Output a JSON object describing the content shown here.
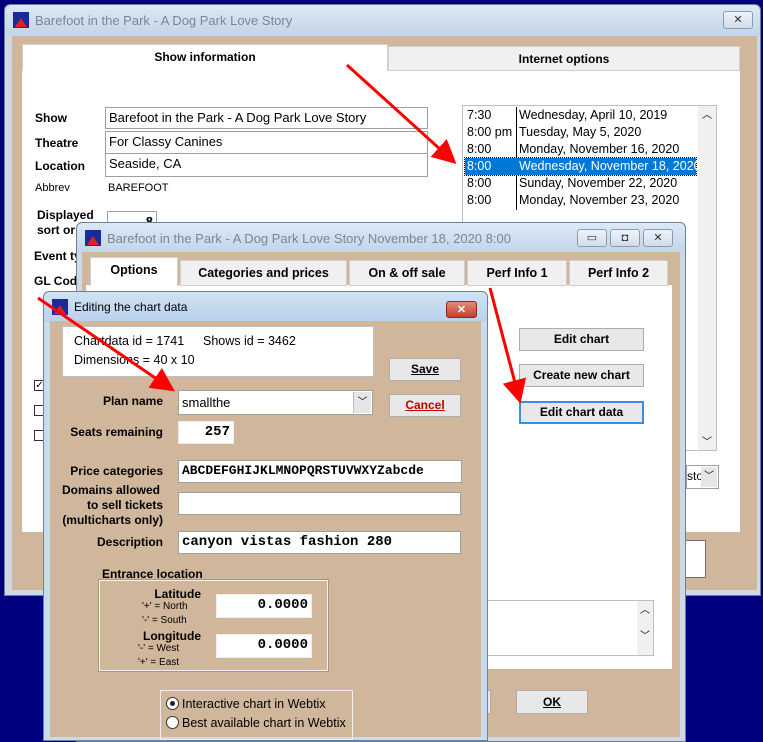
{
  "main_window": {
    "title": "Barefoot in the Park - A Dog Park Love Story",
    "tabs": [
      "Show information",
      "Internet options"
    ],
    "fields": {
      "show_label": "Show",
      "show": "Barefoot in the Park - A Dog Park Love Story",
      "theatre_label": "Theatre",
      "theatre": "For Classy Canines",
      "location_label": "Location",
      "location": "Seaside, CA",
      "abbrev_label": "Abbrev",
      "abbrev": "BAREFOOT",
      "sort_label_1": "Displayed",
      "sort_label_2": "sort or",
      "sort_value": "8",
      "event_label": "Event ty",
      "gl_label": "GL Cod",
      "dropdown_partial": "stor"
    },
    "performances": [
      {
        "time": "7:30",
        "date": "Wednesday, April 10, 2019"
      },
      {
        "time": "8:00 pm",
        "date": "Tuesday, May 5, 2020"
      },
      {
        "time": "8:00",
        "date": "Monday, November 16, 2020"
      },
      {
        "time": "8:00",
        "date": "Wednesday, November 18, 2020",
        "selected": true
      },
      {
        "time": "8:00",
        "date": "Sunday, November 22, 2020"
      },
      {
        "time": "8:00",
        "date": "Monday, November 23, 2020"
      }
    ]
  },
  "perf_window": {
    "title": "Barefoot in the Park - A Dog Park Love Story November 18, 2020 8:00",
    "tabs": [
      "Options",
      "Categories and prices",
      "On & off sale",
      "Perf Info 1",
      "Perf Info 2"
    ],
    "buttons": {
      "edit_chart": "Edit chart",
      "create_chart": "Create new chart",
      "edit_chart_data": "Edit chart data",
      "ok": "OK"
    }
  },
  "chart_dialog": {
    "title": "Editing the chart data",
    "chartdata_id": "Chartdata id = 1741",
    "shows_id": "Shows id = 3462",
    "dimensions": "Dimensions = 40 x 10",
    "save": "Save",
    "cancel": "Cancel",
    "plan_name_label": "Plan name",
    "plan_name": "smallthe",
    "seats_label": "Seats remaining",
    "seats": "257",
    "price_label": "Price categories",
    "price": "ABCDEFGHIJKLMNOPQRSTUVWXYZabcde",
    "domains_label_1": "Domains allowed",
    "domains_label_2": "to sell tickets",
    "domains_label_3": "(multicharts only)",
    "domains": "",
    "description_label": "Description",
    "description": "canyon vistas fashion 280",
    "entrance_label": "Entrance location",
    "lat_label": "Latitude",
    "lat_hint1": "'+' = North",
    "lat_hint2": "'-' = South",
    "latitude": "0.0000",
    "lon_label": "Longitude",
    "lon_hint1": "'-' = West",
    "lon_hint2": "'+' = East",
    "longitude": "0.0000",
    "radio_options": [
      {
        "label": "Interactive chart in Webtix",
        "checked": true
      },
      {
        "label": "Best available chart in Webtix",
        "checked": false
      }
    ]
  },
  "colors": {
    "accent": "#0078d7",
    "annotation": "#ff0000",
    "tan": "#d0b69a",
    "desktop": "#000080"
  }
}
